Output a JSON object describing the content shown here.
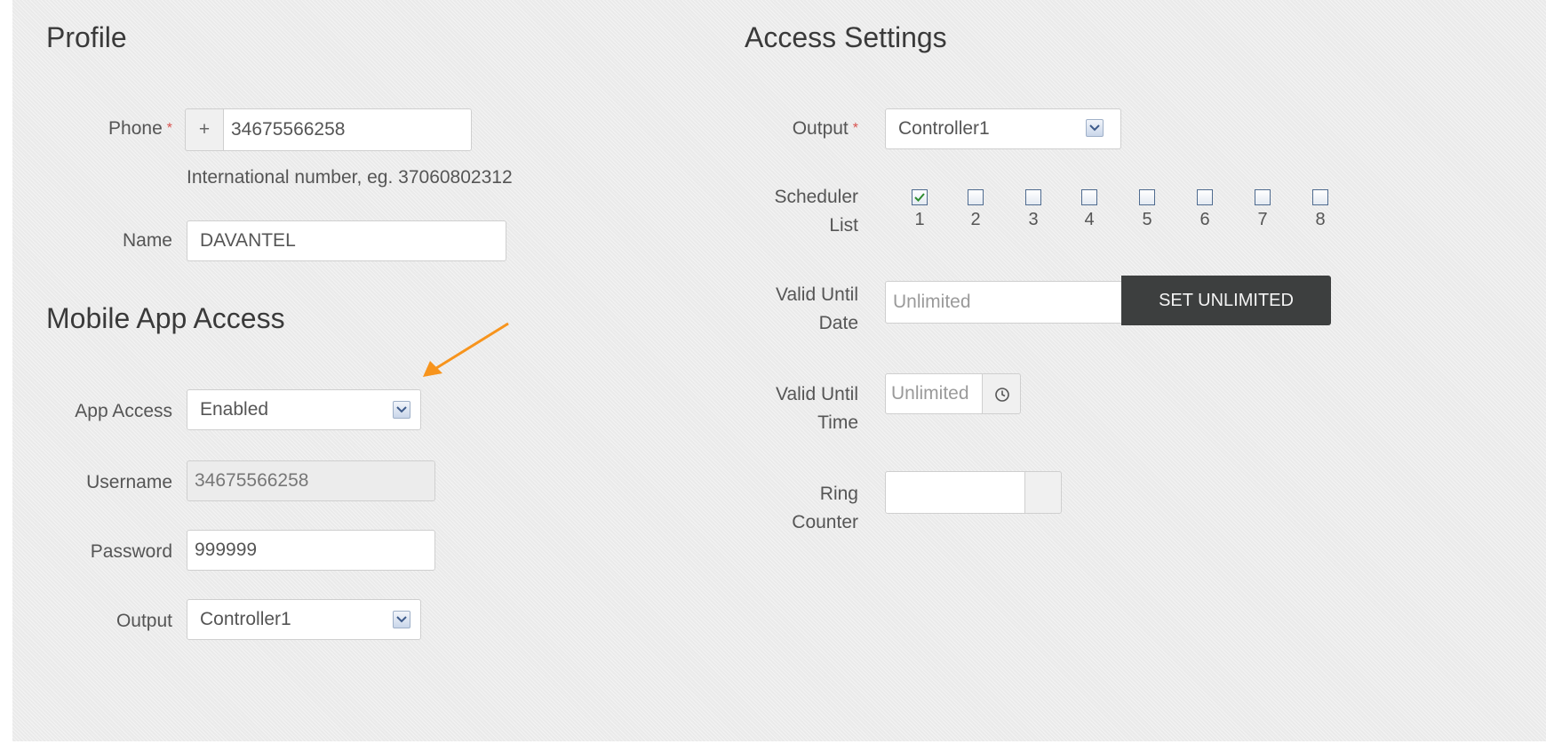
{
  "profile": {
    "title": "Profile",
    "phone": {
      "label": "Phone",
      "required_mark": "*",
      "prefix": "+",
      "value": "34675566258",
      "help": "International number, eg. 37060802312"
    },
    "name": {
      "label": "Name",
      "value": "DAVANTEL"
    }
  },
  "mobile_app": {
    "title": "Mobile App Access",
    "app_access": {
      "label": "App Access",
      "selected": "Enabled"
    },
    "username": {
      "label": "Username",
      "value": "34675566258"
    },
    "password": {
      "label": "Password",
      "value": "999999"
    },
    "output": {
      "label": "Output",
      "selected": "Controller1"
    }
  },
  "access_settings": {
    "title": "Access Settings",
    "output": {
      "label": "Output",
      "required_mark": "*",
      "selected": "Controller1"
    },
    "scheduler": {
      "label_line1": "Scheduler",
      "label_line2": "List",
      "items": [
        {
          "label": "1",
          "checked": true
        },
        {
          "label": "2",
          "checked": false
        },
        {
          "label": "3",
          "checked": false
        },
        {
          "label": "4",
          "checked": false
        },
        {
          "label": "5",
          "checked": false
        },
        {
          "label": "6",
          "checked": false
        },
        {
          "label": "7",
          "checked": false
        },
        {
          "label": "8",
          "checked": false
        }
      ]
    },
    "valid_until_date": {
      "label_line1": "Valid Until",
      "label_line2": "Date",
      "placeholder": "Unlimited",
      "button": "SET UNLIMITED"
    },
    "valid_until_time": {
      "label_line1": "Valid Until",
      "label_line2": "Time",
      "placeholder": "Unlimited",
      "icon": "clock-icon"
    },
    "ring_counter": {
      "label_line1": "Ring",
      "label_line2": "Counter",
      "value": ""
    }
  },
  "colors": {
    "required": "#d9534f",
    "annotation_arrow": "#f7941d",
    "checkmark": "#2e8b2e",
    "dark_button": "#3d3f3f"
  }
}
